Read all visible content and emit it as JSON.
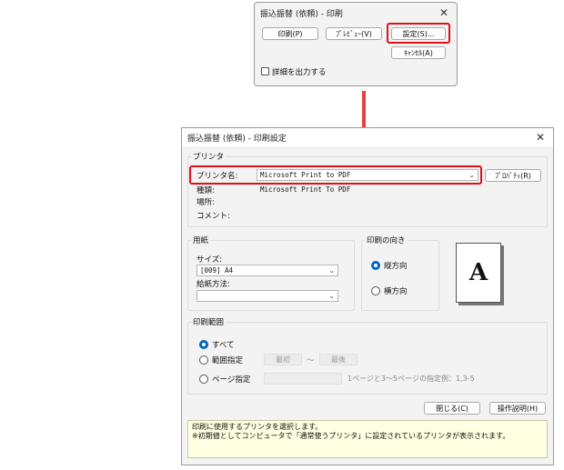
{
  "print_dialog": {
    "title": "振込振替 (依頼) - 印刷",
    "close_glyph": "✕",
    "buttons": {
      "print": "印刷(P)",
      "preview": "ﾌﾟﾚﾋﾞｭｰ(V)",
      "settings": "設定(S)...",
      "cancel": "ｷｬﾝｾﾙ(A)"
    },
    "detail_checkbox": {
      "label": "詳細を出力する",
      "checked": false
    }
  },
  "arrow_color": "#e8403f",
  "highlight_color": "#e0101a",
  "setup_dialog": {
    "title": "振込振替 (依頼) - 印刷設定",
    "close_glyph": "✕",
    "printer_group": {
      "title": "プリンタ",
      "name_label": "プリンタ名:",
      "name_value": "Microsoft Print to PDF",
      "properties_button": "ﾌﾟﾛﾊﾟﾃｨ(R)",
      "type_label": "種類:",
      "type_value": "Microsoft Print To PDF",
      "location_label": "場所:",
      "comment_label": "コメント:"
    },
    "paper_group": {
      "title": "用紙",
      "size_label": "サイズ:",
      "size_value": "[009] A4",
      "source_label": "給紙方法:",
      "source_value": ""
    },
    "orientation_group": {
      "title": "印刷の向き",
      "portrait": "縦方向",
      "landscape": "横方向",
      "selected": "portrait",
      "preview_letter": "A"
    },
    "range_group": {
      "title": "印刷範囲",
      "all": "すべて",
      "range": "範囲指定",
      "first_placeholder": "最初",
      "tilde": "～",
      "last_placeholder": "最後",
      "pages": "ページ指定",
      "pages_hint": "1ページと3～5ページの指定例：1,3-5",
      "selected": "all"
    },
    "buttons": {
      "close": "閉じる(C)",
      "help": "操作説明(H)"
    },
    "hint_lines": [
      "印刷に使用するプリンタを選択します。",
      "※初期値としてコンピュータで「通常使うプリンタ」に設定されているプリンタが表示されます。"
    ]
  }
}
